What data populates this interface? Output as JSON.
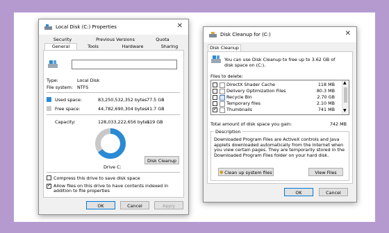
{
  "props": {
    "title": "Local Disk (C:) Properties",
    "tabs_top": [
      "Security",
      "Previous Versions",
      "Quota"
    ],
    "tabs_bottom": [
      "General",
      "Tools",
      "Hardware",
      "Sharing"
    ],
    "name_value": "",
    "type_label": "Type:",
    "type_value": "Local Disk",
    "fs_label": "File system:",
    "fs_value": "NTFS",
    "used_label": "Used space:",
    "used_bytes": "83,250,532,352 bytes",
    "used_gb": "77.5 GB",
    "free_label": "Free space:",
    "free_bytes": "44,782,690,304 bytes",
    "free_gb": "41.7 GB",
    "cap_label": "Capacity:",
    "cap_bytes": "128,033,222,656 bytes",
    "cap_gb": "119 GB",
    "used_fraction": 0.65,
    "drive_label": "Drive C:",
    "disk_cleanup": "Disk Cleanup",
    "compress": "Compress this drive to save disk space",
    "index": "Allow files on this drive to have contents indexed in addition to file properties",
    "ok": "OK",
    "cancel": "Cancel",
    "apply": "Apply",
    "colors": {
      "used": "#2a8ad4",
      "free": "#c8c8c8"
    }
  },
  "cleanup": {
    "title": "Disk Cleanup for  (C:)",
    "tab": "Disk Cleanup",
    "intro": "You can use Disk Cleanup to free up to 3.62 GB of disk space on  (C:).",
    "files_label": "Files to delete:",
    "items": [
      {
        "name": "DirectX Shader Cache",
        "size": "118 MB",
        "checked": false
      },
      {
        "name": "Delivery Optimization Files",
        "size": "80.3 MB",
        "checked": false
      },
      {
        "name": "Recycle Bin",
        "size": "2.70 GB",
        "checked": false
      },
      {
        "name": "Temporary files",
        "size": "2.10 MB",
        "checked": false
      },
      {
        "name": "Thumbnails",
        "size": "741 MB",
        "checked": true
      }
    ],
    "total_label": "Total amount of disk space you gain:",
    "total_value": "742 MB",
    "desc_label": "Description",
    "desc_text": "Downloaded Program Files are ActiveX controls and Java applets downloaded automatically from the Internet when you view certain pages. They are temporarily stored in the Downloaded Program Files folder on your hard disk.",
    "cleanup_sys": "Clean up system files",
    "view_files": "View Files",
    "ok": "OK",
    "cancel": "Cancel"
  }
}
